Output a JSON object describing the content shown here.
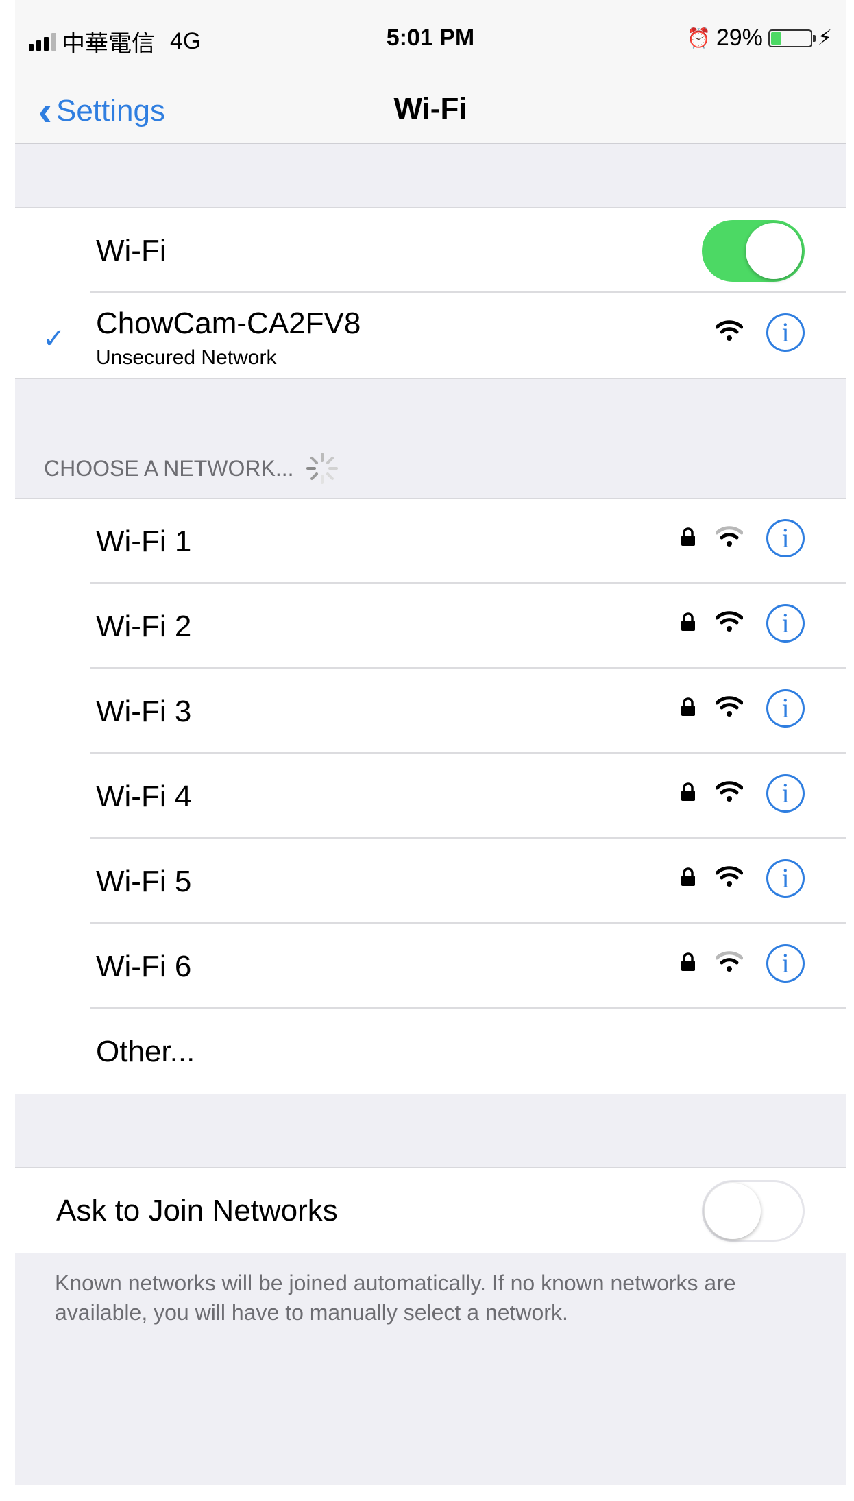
{
  "status_bar": {
    "carrier": "中華電信",
    "network_type": "4G",
    "time": "5:01 PM",
    "battery_percent": "29%",
    "battery_level": 0.29
  },
  "nav": {
    "back_label": "Settings",
    "title": "Wi-Fi"
  },
  "wifi_toggle": {
    "label": "Wi-Fi",
    "on": true
  },
  "connected_network": {
    "name": "ChowCam-CA2FV8",
    "subtitle": "Unsecured Network",
    "signal_bars": 3
  },
  "choose_header": "CHOOSE A NETWORK...",
  "networks": [
    {
      "name": "Wi-Fi 1",
      "locked": true,
      "signal_bars": 2
    },
    {
      "name": "Wi-Fi 2",
      "locked": true,
      "signal_bars": 3
    },
    {
      "name": "Wi-Fi 3",
      "locked": true,
      "signal_bars": 3
    },
    {
      "name": "Wi-Fi 4",
      "locked": true,
      "signal_bars": 3
    },
    {
      "name": "Wi-Fi 5",
      "locked": true,
      "signal_bars": 3
    },
    {
      "name": "Wi-Fi 6",
      "locked": true,
      "signal_bars": 2
    }
  ],
  "other_label": "Other...",
  "ask_to_join": {
    "label": "Ask to Join Networks",
    "on": false
  },
  "footer": "Known networks will be joined automatically. If no known networks are available, you will have to manually select a network.",
  "colors": {
    "accent": "#2f7ee0",
    "toggle_on": "#4cd964",
    "background": "#efeff4"
  },
  "icons": [
    "signal-bars-icon",
    "alarm-icon",
    "battery-icon",
    "charging-bolt-icon",
    "back-chevron-icon",
    "checkmark-icon",
    "wifi-signal-icon",
    "lock-icon",
    "info-icon",
    "spinner-icon"
  ]
}
